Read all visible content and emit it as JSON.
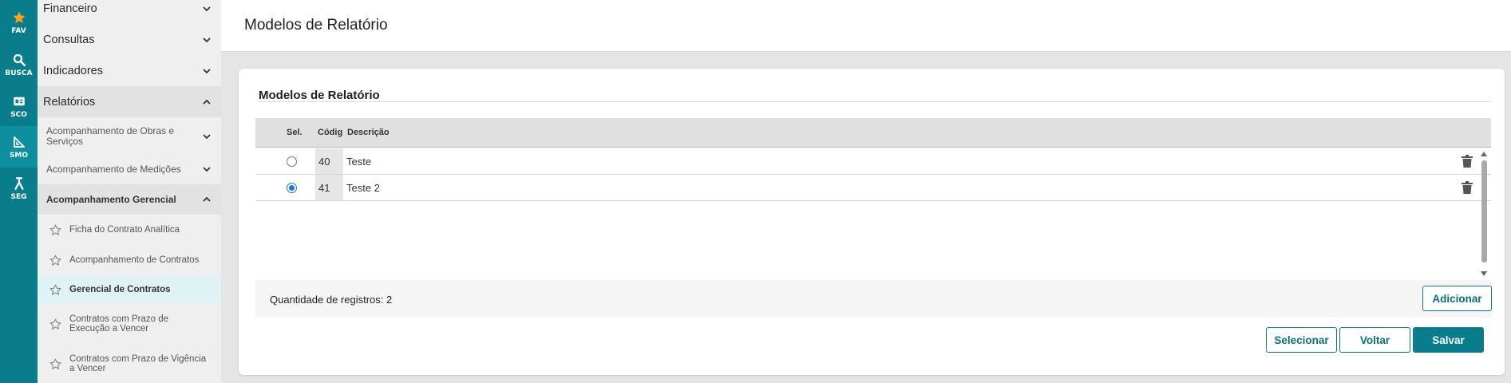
{
  "rail": [
    {
      "label": "FAV",
      "icon": "star-icon"
    },
    {
      "label": "BUSCA",
      "icon": "search-icon"
    },
    {
      "label": "SCO",
      "icon": "card-icon"
    },
    {
      "label": "SMO",
      "icon": "ruler-icon"
    },
    {
      "label": "SEG",
      "icon": "person-icon"
    }
  ],
  "sidebar": {
    "financeiro": "Financeiro",
    "consultas": "Consultas",
    "indicadores": "Indicadores",
    "relatorios": "Relatórios",
    "obras": "Acompanhamento de Obras e Serviços",
    "medicoes": "Acompanhamento de Medições",
    "gerencial": "Acompanhamento Gerencial",
    "ficha": "Ficha do Contrato Analítica",
    "contratos": "Acompanhamento de Contratos",
    "gerencial_contratos": "Gerencial de Contratos",
    "prazo_execucao": "Contratos com Prazo de Execução a Vencer",
    "prazo_vigencia": "Contratos com Prazo de Vigência a Vencer"
  },
  "header": {
    "title": "Modelos de Relatório"
  },
  "card": {
    "title": "Modelos de Relatório",
    "columns": {
      "sel": "Sel.",
      "codigo": "Códig",
      "descricao": "Descrição"
    },
    "rows": [
      {
        "code": "40",
        "description": "Teste",
        "selected": false
      },
      {
        "code": "41",
        "description": "Teste 2",
        "selected": true
      }
    ],
    "count_text": "Quantidade de registros: 2",
    "add_label": "Adicionar",
    "select_label": "Selecionar",
    "back_label": "Voltar",
    "save_label": "Salvar"
  },
  "colors": {
    "accent": "#0a7d8c",
    "radio": "#1a73e8"
  }
}
